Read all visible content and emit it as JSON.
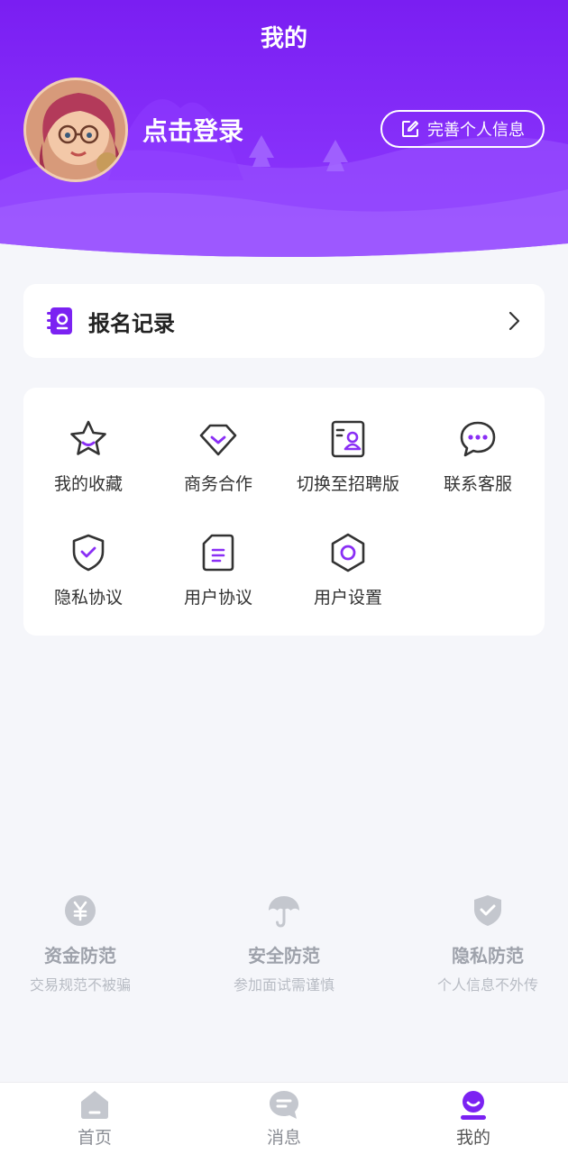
{
  "header": {
    "title": "我的",
    "login_text": "点击登录",
    "edit_profile_label": "完善个人信息"
  },
  "record": {
    "label": "报名记录"
  },
  "menu": [
    {
      "label": "我的收藏",
      "icon": "star-icon"
    },
    {
      "label": "商务合作",
      "icon": "diamond-icon"
    },
    {
      "label": "切换至招聘版",
      "icon": "resume-card-icon"
    },
    {
      "label": "联系客服",
      "icon": "chat-bubble-icon"
    },
    {
      "label": "隐私协议",
      "icon": "shield-check-icon"
    },
    {
      "label": "用户协议",
      "icon": "document-icon"
    },
    {
      "label": "用户设置",
      "icon": "settings-hexagon-icon"
    }
  ],
  "safety": [
    {
      "title": "资金防范",
      "subtitle": "交易规范不被骗",
      "icon": "yen-coin-icon"
    },
    {
      "title": "安全防范",
      "subtitle": "参加面试需谨慎",
      "icon": "umbrella-icon"
    },
    {
      "title": "隐私防范",
      "subtitle": "个人信息不外传",
      "icon": "shield-check-icon"
    }
  ],
  "tabbar": [
    {
      "label": "首页",
      "icon": "home-icon"
    },
    {
      "label": "消息",
      "icon": "message-icon"
    },
    {
      "label": "我的",
      "icon": "profile-icon",
      "active": true
    }
  ],
  "colors": {
    "brand_purple": "#7b22f2",
    "brand_purple_light": "#9a4dff",
    "page_background": "#f5f6fa",
    "muted_icon": "#c0c4cc"
  }
}
